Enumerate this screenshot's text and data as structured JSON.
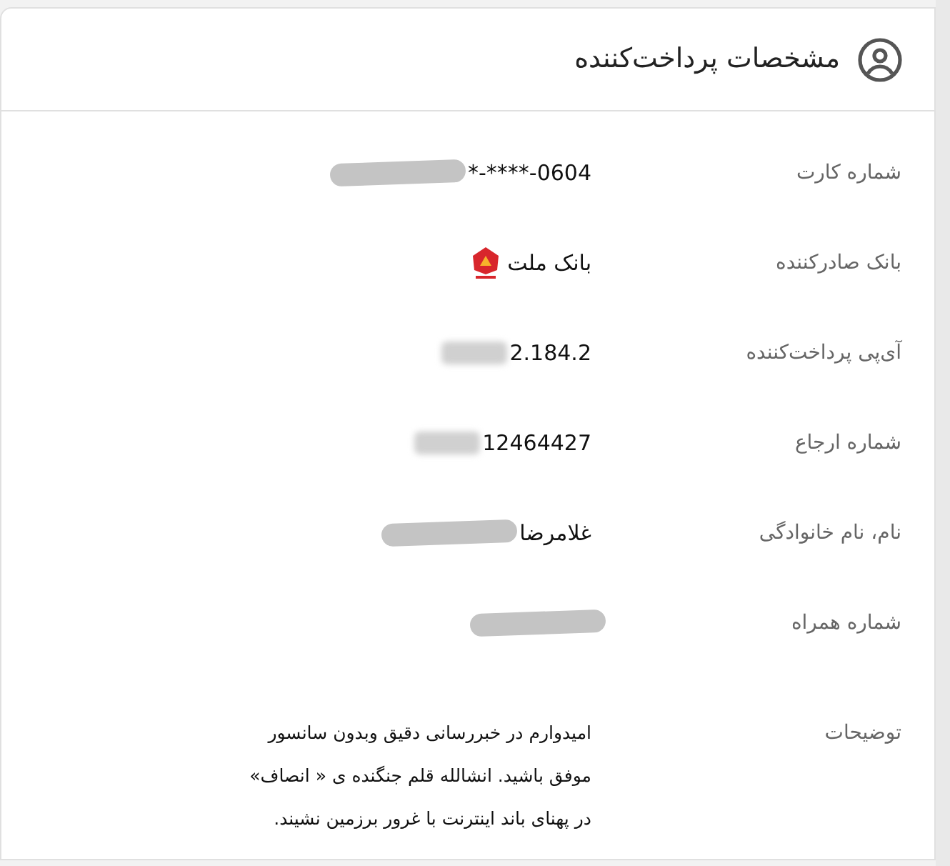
{
  "card": {
    "title": "مشخصات پرداخت‌کننده"
  },
  "rows": [
    {
      "label": "شماره کارت",
      "kind": "text",
      "value": "*-****-0604",
      "ltr": true,
      "redacted": true
    },
    {
      "label": "بانک صادرکننده",
      "kind": "bank",
      "value": "بانک ملت"
    },
    {
      "label": "آی‌پی پرداخت‌کننده",
      "kind": "text",
      "value": "2.184.2",
      "blurred": true
    },
    {
      "label": "شماره ارجاع",
      "kind": "text",
      "value": "12464427",
      "blurred": true
    },
    {
      "label": "نام، نام خانوادگی",
      "kind": "text",
      "value": "غلامرضا",
      "redacted": true
    },
    {
      "label": "شماره همراه",
      "kind": "masked",
      "redacted": true
    },
    {
      "label": "توضیحات",
      "kind": "paragraph",
      "value": "امیدوارم در خبررسانی دقیق وبدون سانسور موفق باشید. انشالله قلم جنگنده ی « انصاف» در پهنای باند اینترنت با غرور برزمین نشیند."
    }
  ]
}
